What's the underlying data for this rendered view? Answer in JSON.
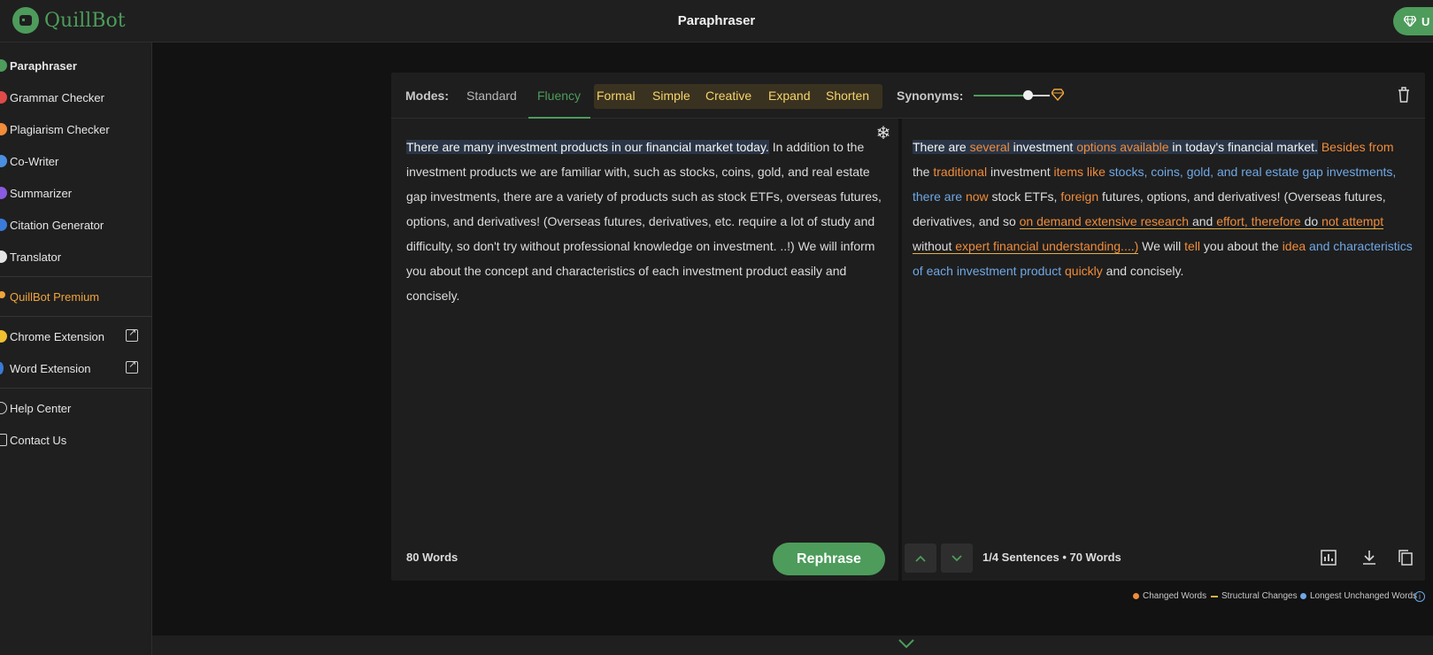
{
  "header": {
    "logo_text": "QuillBot",
    "title": "Paraphraser",
    "upgrade_label": "U"
  },
  "sidebar": {
    "items": [
      {
        "label": "Paraphraser",
        "color": "#4d9c5b"
      },
      {
        "label": "Grammar Checker",
        "color": "#e04a4a"
      },
      {
        "label": "Plagiarism Checker",
        "color": "#f08c3a"
      },
      {
        "label": "Co-Writer",
        "color": "#4a8fe0"
      },
      {
        "label": "Summarizer",
        "color": "#8a5ae0"
      },
      {
        "label": "Citation Generator",
        "color": "#3a7ad8"
      },
      {
        "label": "Translator",
        "color": "#e6e6e6"
      }
    ],
    "premium_label": "QuillBot Premium",
    "extensions": [
      {
        "label": "Chrome Extension",
        "color": "#f0c030"
      },
      {
        "label": "Word Extension",
        "color": "#3a7ad8"
      }
    ],
    "support": [
      {
        "label": "Help Center"
      },
      {
        "label": "Contact Us"
      }
    ]
  },
  "editor": {
    "modes_label": "Modes:",
    "modes": [
      "Standard",
      "Fluency"
    ],
    "active_mode": "Fluency",
    "premium_modes": [
      "Formal",
      "Simple",
      "Creative",
      "Expand",
      "Shorten"
    ],
    "synonyms_label": "Synonyms:",
    "synonyms_level": 0.7,
    "input_words": "80 Words",
    "rephrase_label": "Rephrase",
    "output_stats": "1/4 Sentences • 70 Words",
    "input": {
      "highlight": "There are many investment products in our financial market today.",
      "rest": " In addition to the investment products we are familiar with, such as stocks, coins, gold, and real estate gap investments, there are a variety of products such as stock ETFs, overseas futures, options, and derivatives! (Overseas futures, derivatives, etc. require a lot of study and difficulty, so don't try without professional knowledge on investment. ..!) We will inform you about the concept and characteristics of each investment product easily and concisely."
    },
    "output": {
      "s1": [
        "There are ",
        "several",
        " investment ",
        "options available",
        " in today's financial market."
      ],
      "s2": [
        " ",
        "Besides from",
        " the ",
        "traditional",
        " investment ",
        "items like",
        " ",
        "stocks, coins, gold, and real estate gap investments, there are",
        " ",
        "now",
        " stock ETFs, ",
        "foreign",
        " futures, options, and derivatives!"
      ],
      "s3": [
        " (Overseas futures, derivatives, and so ",
        "on",
        " ",
        "demand extensive research",
        " and ",
        "effort, therefore",
        " do ",
        "not attempt",
        " without ",
        "expert financial",
        " ",
        "understanding....)"
      ],
      "s4": [
        " We will ",
        "tell",
        " you about the ",
        "idea",
        " ",
        "and characteristics of each investment product",
        " ",
        "quickly",
        " and concisely."
      ]
    }
  },
  "legend": [
    {
      "label": "Changed Words",
      "color": "#f08c3a"
    },
    {
      "label": "Structural Changes",
      "color": "#e0b048"
    },
    {
      "label": "Longest Unchanged Words",
      "color": "#6fa8e6"
    }
  ]
}
